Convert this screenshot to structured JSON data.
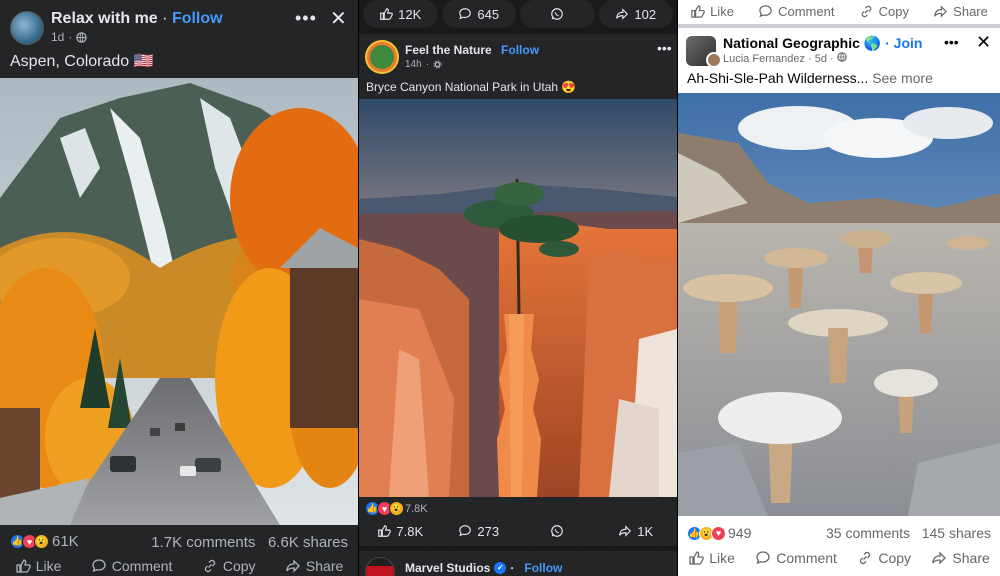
{
  "panel1": {
    "author": "Relax with me",
    "separator": "·",
    "follow_label": "Follow",
    "time": "1d",
    "caption": "Aspen, Colorado 🇺🇸",
    "reaction_count": "61K",
    "comments": "1.7K comments",
    "shares": "6.6K shares",
    "actions": {
      "like": "Like",
      "comment": "Comment",
      "copy": "Copy",
      "share": "Share"
    }
  },
  "panel2": {
    "top_bar": {
      "likes": "12K",
      "comments": "645",
      "shares": "102"
    },
    "author": "Feel the Nature",
    "follow_label": "Follow",
    "time": "14h",
    "caption": "Bryce Canyon National Park in Utah 😍",
    "reaction_count": "7.8K",
    "bottom_bar": {
      "likes": "7.8K",
      "comments": "273",
      "shares": "1K"
    },
    "next_post": {
      "author": "Marvel Studios",
      "follow_label": "Follow",
      "separator": "·"
    }
  },
  "panel3": {
    "top_actions": {
      "like": "Like",
      "comment": "Comment",
      "copy": "Copy",
      "share": "Share"
    },
    "group": "National Geographic 🌎",
    "join_label": "· Join",
    "author_meta": "Lucia Fernandez · 5d ·",
    "caption": "Ah-Shi-Sle-Pah Wilderness...",
    "see_more": "See more",
    "reaction_count": "949",
    "comments": "35 comments",
    "shares": "145 shares",
    "actions": {
      "like": "Like",
      "comment": "Comment",
      "copy": "Copy",
      "share": "Share"
    }
  },
  "colors": {
    "link_blue": "#4599ff",
    "fb_blue": "#1877f2",
    "dark_card": "#242526",
    "love_red": "#f33e58",
    "wow_yellow": "#f7b125"
  },
  "icons": [
    "globe-icon",
    "gear-icon",
    "like-icon",
    "comment-icon",
    "copy-icon",
    "share-icon",
    "whatsapp-icon",
    "more-icon",
    "close-icon",
    "verified-icon"
  ]
}
